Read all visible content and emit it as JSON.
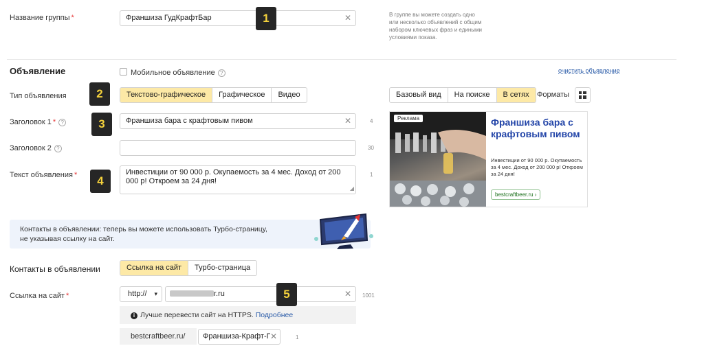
{
  "group": {
    "label": "Название группы",
    "required": "*",
    "value": "Франшиза ГудКрафтБар",
    "badge": "1",
    "hint": [
      "В группе вы можете создать одно",
      "или несколько объявлений с общим",
      "набором ключевых фраз и едиными",
      "условиями показа."
    ]
  },
  "ad": {
    "section_title": "Объявление",
    "mobile_label": "Мобильное объявление",
    "clear_link": "очистить объявление",
    "type_label": "Тип объявления",
    "type_badge": "2",
    "types": [
      "Текстово-графическое",
      "Графическое",
      "Видео"
    ],
    "title1_label": "Заголовок 1",
    "title1_value": "Франшиза бара с крафтовым пивом",
    "title1_badge": "3",
    "title1_counter": "4",
    "title2_label": "Заголовок 2",
    "title2_value": "",
    "title2_counter": "30",
    "text_label": "Текст объявления",
    "text_badge": "4",
    "text_value": "Инвестиции от 90 000 р. Окупаемость за 4 мес. Доход от 200 000 р! Откроем за 24 дня!",
    "text_counter": "1"
  },
  "preview": {
    "tabs": [
      "Базовый вид",
      "На поиске",
      "В сетях"
    ],
    "formats_label": "Форматы",
    "ad_tag": "Реклама",
    "headline": "Франшиза бара с крафтовым пивом",
    "body": "Инвестиции от 90 000 р. Окупаемость за 4 мес. Доход от 200 000 р! Откроем за 24 дня!",
    "domain_button": "bestcraftbeer.ru ›"
  },
  "banner": {
    "text_line1": "Контакты в объявлении: теперь вы можете использовать Турбо-страницу,",
    "text_line2": "не указывая ссылку на сайт."
  },
  "contacts": {
    "label": "Контакты в объявлении",
    "options": [
      "Ссылка на сайт",
      "Турбо-страница"
    ],
    "site_label": "Ссылка на сайт",
    "protocol": "http://",
    "url_suffix": "r.ru",
    "url_badge": "5",
    "url_counter": "1001",
    "https_note": "Лучше перевести сайт на HTTPS.",
    "https_more": "Подробнее",
    "display_domain": "bestcraftbeer.ru/",
    "display_path": "Франшиза-Крафт-П",
    "display_counter": "1"
  },
  "colors": {
    "accent": "#fde9a6",
    "badge_bg": "#262626",
    "badge_fg": "#f5d23c",
    "link": "#2a5ba8",
    "preview_headline": "#2345a8",
    "banner_bg": "#eef3fb"
  }
}
